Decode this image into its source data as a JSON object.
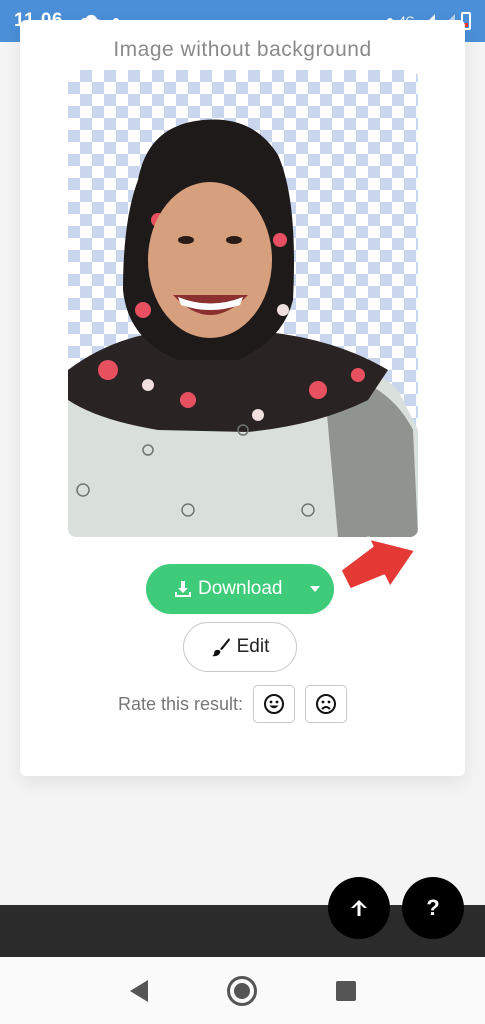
{
  "status_bar": {
    "time": "11.06",
    "network": "4G"
  },
  "card": {
    "title": "Image without background"
  },
  "download": {
    "label": "Download"
  },
  "edit": {
    "label": "Edit"
  },
  "rating": {
    "label": "Rate this result:"
  },
  "fab": {
    "help_label": "?"
  },
  "colors": {
    "primary_green": "#3ecb7a",
    "status_bar_blue": "#4b8fd8",
    "annotation_red": "#e53935"
  },
  "icons": {
    "status": [
      "cloud-icon",
      "dot-icon",
      "signal-icon",
      "battery-icon"
    ],
    "buttons": [
      "download-icon",
      "chevron-down-icon",
      "brush-icon",
      "smile-icon",
      "frown-icon",
      "arrow-up-icon"
    ],
    "nav": [
      "back-icon",
      "home-icon",
      "recents-icon"
    ]
  }
}
